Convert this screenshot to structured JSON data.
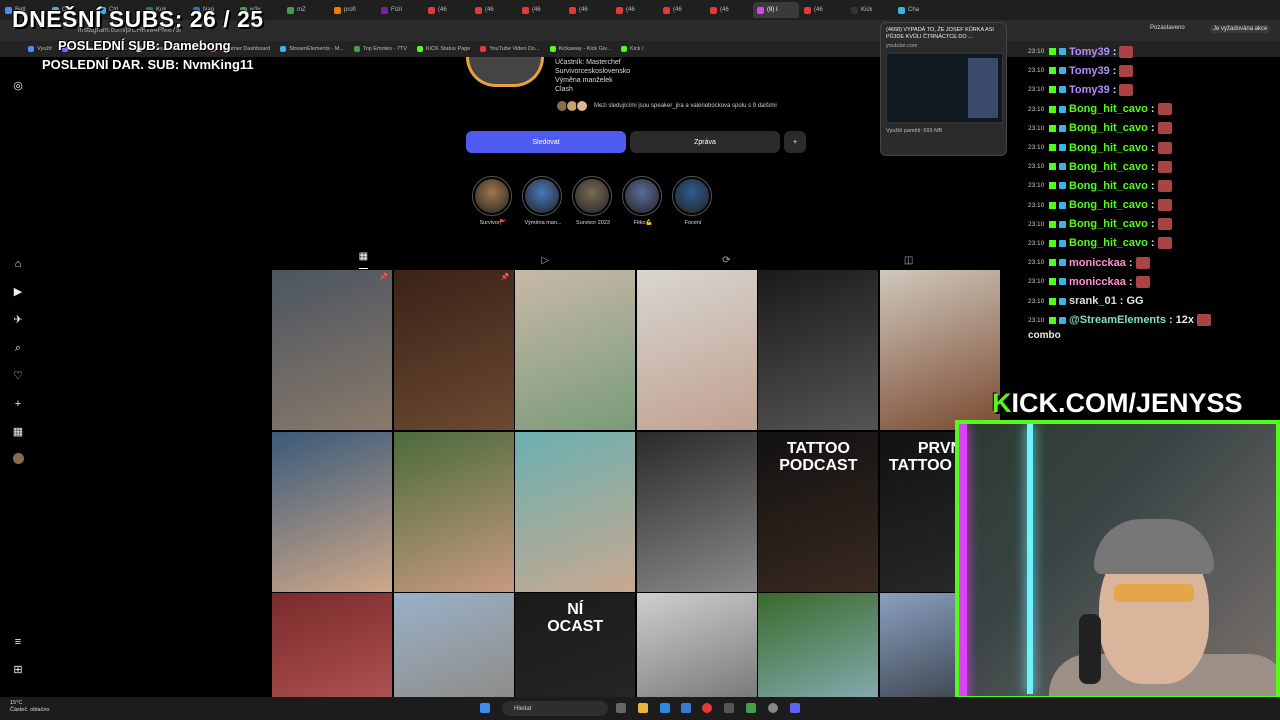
{
  "browser": {
    "tabs": [
      {
        "label": "BetI",
        "color": "#4a8cff"
      },
      {
        "label": "Ctrl",
        "color": "#3bb3e6"
      },
      {
        "label": "Ctrl",
        "color": "#3bb3e6"
      },
      {
        "label": "Kuk",
        "color": "#2e7d32"
      },
      {
        "label": "Nap",
        "color": "#1976d2"
      },
      {
        "label": "w3v",
        "color": "#43a047"
      },
      {
        "label": "mZ",
        "color": "#43a047"
      },
      {
        "label": "profi",
        "color": "#f57c00"
      },
      {
        "label": "FiziI",
        "color": "#7b1fa2"
      },
      {
        "label": "(46",
        "color": "#e53935"
      },
      {
        "label": "(46",
        "color": "#e53935"
      },
      {
        "label": "(46",
        "color": "#e53935"
      },
      {
        "label": "(46",
        "color": "#e53935"
      },
      {
        "label": "(46",
        "color": "#e53935"
      },
      {
        "label": "(46",
        "color": "#e53935"
      },
      {
        "label": "(46",
        "color": "#e53935"
      },
      {
        "label": "(8) I",
        "color": "#e040fb"
      },
      {
        "label": "(46",
        "color": "#e53935"
      },
      {
        "label": "Kick",
        "color": "#333"
      },
      {
        "label": "Cha",
        "color": "#3bb3e6"
      }
    ],
    "url": "instagram.com/p/CHKil84PM873/",
    "profile_chip": "Pozastaveno",
    "update_chip": "Je vyžadována akce",
    "bookmarks": [
      "Využit",
      "File Converter - Free...",
      "The best ChatBot an...",
      "Streamer Dashboard",
      "StreamElements - M...",
      "Top Emotes - 7TV",
      "KICK Status Page",
      "YouTube Video Do...",
      "Kickaway - Kick Giv...",
      "Kick /"
    ]
  },
  "overlay": {
    "subs_line": "DNEŠNÍ SUBS: 26 / 25",
    "last_sub": "POSLEDNÍ SUB: Damebong",
    "last_donation": "POSLEDNÍ DAR. SUB: NvmKing11",
    "kick_prefix": "K",
    "kick_rest": "ICK.COM/JENYSS"
  },
  "profile": {
    "bio": [
      "Účastník: Masterchef",
      "Survivorceskoslovensko",
      "Výměna manželek",
      "Clash"
    ],
    "followers_text": "Mezi sledujícími jsou speaker_jira a valeriebockova spolu s 9 dalšími",
    "follow_label": "Sledovat",
    "message_label": "Zpráva",
    "add_label": "+",
    "highlights": [
      {
        "label": "Survivor🚩",
        "color": "#a0784a"
      },
      {
        "label": "Výměna man...",
        "color": "#4878b8"
      },
      {
        "label": "Survivor 2023",
        "color": "#7a6b56"
      },
      {
        "label": "Fitko💪",
        "color": "#5a6d9a"
      },
      {
        "label": "Focení",
        "color": "#2f5c8f"
      }
    ]
  },
  "tabs_icons": [
    "grid-icon",
    "reels-icon",
    "repost-icon",
    "tagged-icon"
  ],
  "posts": [
    {
      "c1": "#4b5560",
      "c2": "#8a7a6a",
      "pin": "📌"
    },
    {
      "c1": "#3a2218",
      "c2": "#6b4a30",
      "pin": "📌"
    },
    {
      "c1": "#c7b9a8",
      "c2": "#7a9b7a",
      "pin": ""
    },
    {
      "c1": "#d8d6d0",
      "c2": "#c0a090",
      "pin": ""
    },
    {
      "c1": "#1a1a1a",
      "c2": "#555555",
      "pin": ""
    },
    {
      "c1": "#d0c8bc",
      "c2": "#7a4a30",
      "pin": ""
    },
    {
      "c1": "#3a5a7a",
      "c2": "#cfa888",
      "pin": ""
    },
    {
      "c1": "#4a6b3a",
      "c2": "#c89a80",
      "pin": ""
    },
    {
      "c1": "#6ab0b0",
      "c2": "#c8a890",
      "pin": ""
    },
    {
      "c1": "#2a2a2a",
      "c2": "#8a8a8a",
      "pin": ""
    },
    {
      "c1": "#111111",
      "c2": "#3a2a20",
      "text": "TATTOO\nPODCAST",
      "pin": ""
    },
    {
      "c1": "#111111",
      "c2": "#2a2a2a",
      "text": "PRVN\nTATTOO POD",
      "pin": ""
    },
    {
      "c1": "#7a2a2a",
      "c2": "#c06060",
      "pin": ""
    },
    {
      "c1": "#9ab0c8",
      "c2": "#8a8070",
      "pin": ""
    },
    {
      "c1": "#1a1a1a",
      "c2": "#2a2a2a",
      "text": "NÍ\nOCAST",
      "pin": ""
    },
    {
      "c1": "#cfcfcf",
      "c2": "#5a5a5a",
      "pin": ""
    },
    {
      "c1": "#3a6a2a",
      "c2": "#a0c0e0",
      "pin": ""
    },
    {
      "c1": "#8aa0c0",
      "c2": "#1a1a1a",
      "pin": ""
    }
  ],
  "chat": [
    {
      "time": "23:10",
      "user": "Tomy39",
      "color": "#b48cff",
      "msg": ":"
    },
    {
      "time": "23:10",
      "user": "Tomy39",
      "color": "#b48cff",
      "msg": ":"
    },
    {
      "time": "23:10",
      "user": "Tomy39",
      "color": "#b48cff",
      "msg": ":"
    },
    {
      "time": "23:10",
      "user": "Bong_hit_cavo",
      "color": "#53fc18",
      "msg": ":"
    },
    {
      "time": "23:10",
      "user": "Bong_hit_cavo",
      "color": "#53fc18",
      "msg": ":"
    },
    {
      "time": "23:10",
      "user": "Bong_hit_cavo",
      "color": "#53fc18",
      "msg": ":"
    },
    {
      "time": "23:10",
      "user": "Bong_hit_cavo",
      "color": "#53fc18",
      "msg": ":"
    },
    {
      "time": "23:10",
      "user": "Bong_hit_cavo",
      "color": "#53fc18",
      "msg": ":"
    },
    {
      "time": "23:10",
      "user": "Bong_hit_cavo",
      "color": "#53fc18",
      "msg": ":"
    },
    {
      "time": "23:10",
      "user": "Bong_hit_cavo",
      "color": "#53fc18",
      "msg": ":"
    },
    {
      "time": "23:10",
      "user": "Bong_hit_cavo",
      "color": "#53fc18",
      "msg": ":"
    },
    {
      "time": "23:10",
      "user": "monicckaa",
      "color": "#ff8fd0",
      "msg": ":"
    },
    {
      "time": "23:10",
      "user": "monicckaa",
      "color": "#ff8fd0",
      "msg": ":"
    },
    {
      "time": "23:10",
      "user": "srank_01",
      "color": "#dddddd",
      "msg": ": GG"
    },
    {
      "time": "23:10",
      "user": "@StreamElements",
      "color": "#7fe0c0",
      "msg": ": 12x"
    }
  ],
  "chat_combo": "combo",
  "tooltip": {
    "title": "(4668) VYPADÁ TO, ŽE JOSEF KŮRKA ASI PŮJDE KVŮLI ČTRNÁCTCE DO ...",
    "host": "youtube.com",
    "memory": "Využití paměti: 693 MB"
  },
  "taskbar": {
    "temp": "15°C",
    "weather": "Částeč. oblačno",
    "search_placeholder": "Hledat"
  },
  "colors": {
    "kick_green": "#53fc18",
    "follow_blue": "#4f5bf0",
    "neon_pink": "#e040fb"
  }
}
